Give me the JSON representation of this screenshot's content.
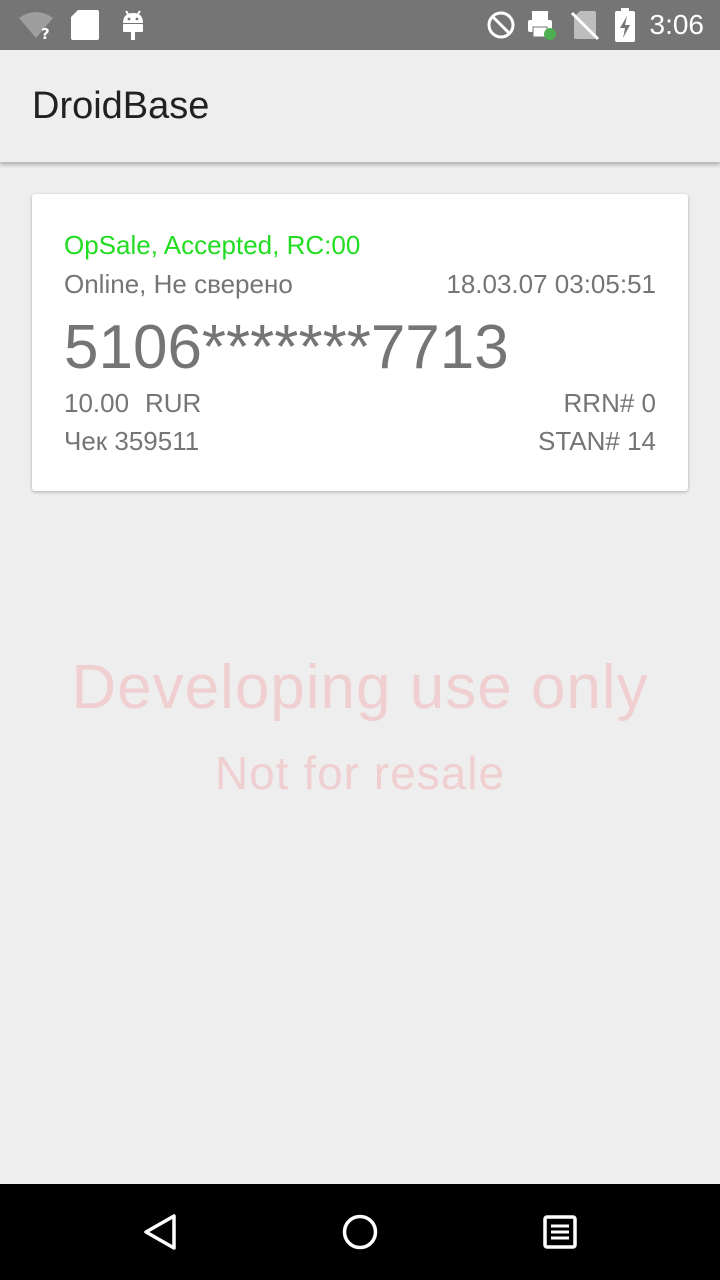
{
  "status_bar": {
    "time": "3:06",
    "icons": [
      "wifi-question-icon",
      "sd-card-icon",
      "android-icon",
      "do-not-disturb-icon",
      "printer-icon",
      "no-sim-icon",
      "battery-charging-icon"
    ]
  },
  "app_bar": {
    "title": "DroidBase"
  },
  "transaction": {
    "status": "OpSale, Accepted, RC:00",
    "mode": "Online, Не сверено",
    "datetime": "18.03.07 03:05:51",
    "pan": "5106*******7713",
    "amount": "10.00",
    "currency": "RUR",
    "rrn": "RRN# 0",
    "check": "Чек 359511",
    "stan": "STAN# 14"
  },
  "watermark": {
    "line1": "Developing use only",
    "line2": "Not for resale"
  },
  "nav_bar": {
    "buttons": [
      "back-icon",
      "home-icon",
      "recents-icon"
    ]
  },
  "colors": {
    "status_bar_bg": "#757575",
    "app_bar_bg": "#eeeeee",
    "accepted_green": "#22dd22",
    "secondary_text": "#757575",
    "watermark": "#f0cfd1",
    "nav_bar_bg": "#000000"
  }
}
